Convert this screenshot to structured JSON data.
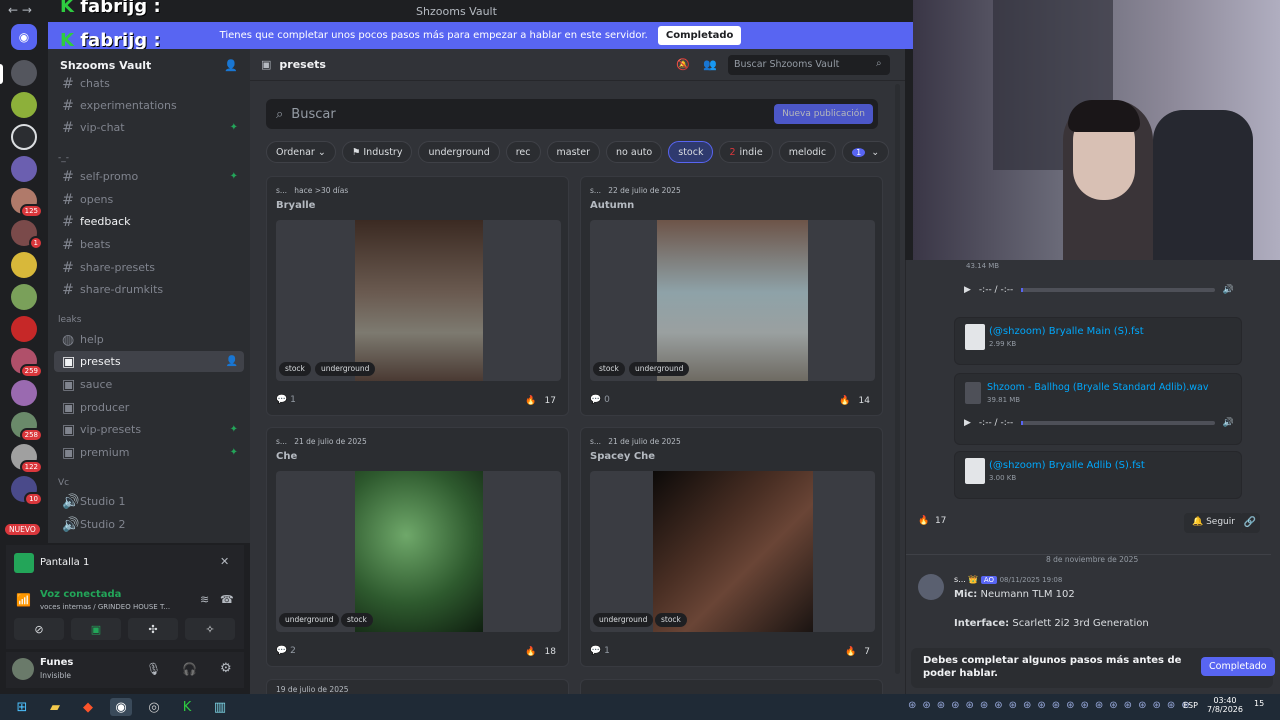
{
  "window": {
    "title": "Shzooms Vault",
    "nav": "← →"
  },
  "overlay_text": "fabrijg :",
  "notice": {
    "text": "Tienes que completar unos pocos pasos más para empezar a hablar en este servidor.",
    "button": "Completado"
  },
  "server": {
    "name": "Shzooms Vault"
  },
  "sidebar": {
    "items": [
      {
        "label": "chats"
      },
      {
        "label": "experimentations"
      },
      {
        "label": "vip-chat"
      },
      {
        "label": "self-promo"
      },
      {
        "label": "opens"
      },
      {
        "label": "feedback"
      },
      {
        "label": "beats"
      },
      {
        "label": "share-presets"
      },
      {
        "label": "share-drumkits"
      },
      {
        "label": "help"
      },
      {
        "label": "presets"
      },
      {
        "label": "sauce"
      },
      {
        "label": "producer"
      },
      {
        "label": "vip-presets"
      },
      {
        "label": "premium"
      },
      {
        "label": "Studio 1"
      },
      {
        "label": "Studio 2"
      }
    ],
    "categories": {
      "c1": "-_-",
      "leaks": "leaks",
      "vc": "Vc"
    }
  },
  "rail_badges": [
    "125",
    "1",
    "259",
    "258",
    "122",
    "10"
  ],
  "rail_new": "NUEVO",
  "voice": {
    "screen": "Pantalla 1",
    "status": "Voz conectada",
    "channel": "voces internas / GRINDEO HOUSE T..."
  },
  "user": {
    "name": "Funes",
    "status": "Invisible"
  },
  "channel": {
    "name": "presets",
    "search_placeholder": "Buscar Shzooms Vault"
  },
  "forum": {
    "search_placeholder": "Buscar",
    "new_post": "Nueva publicación",
    "sort": "Ordenar",
    "tags": [
      {
        "label": "Industry"
      },
      {
        "label": "underground"
      },
      {
        "label": "rec"
      },
      {
        "label": "master"
      },
      {
        "label": "no auto"
      },
      {
        "label": "stock"
      },
      {
        "label": "indie",
        "count": "2"
      },
      {
        "label": "melodic"
      },
      {
        "label": "",
        "count": "1"
      }
    ],
    "posts": [
      {
        "author": "s...",
        "date": "hace >30 días",
        "title": "Bryalle",
        "tags": [
          "stock",
          "underground"
        ],
        "comments": "1",
        "reactions": "17"
      },
      {
        "author": "s...",
        "date": "22 de julio de 2025",
        "title": "Autumn",
        "tags": [
          "stock",
          "underground"
        ],
        "comments": "0",
        "reactions": "14"
      },
      {
        "author": "s...",
        "date": "21 de julio de 2025",
        "title": "Che",
        "tags": [
          "underground",
          "stock"
        ],
        "comments": "2",
        "reactions": "18"
      },
      {
        "author": "s...",
        "date": "21 de julio de 2025",
        "title": "Spacey Che",
        "tags": [
          "underground",
          "stock"
        ],
        "comments": "1",
        "reactions": "7"
      }
    ],
    "next_date": "19 de julio de 2025"
  },
  "thread": {
    "audio1": {
      "size": "43.14 MB",
      "time": "-:-- / -:--"
    },
    "file1": {
      "name": "(@shzoom) Bryalle Main (S).fst",
      "size": "2.99 KB"
    },
    "audio2": {
      "name": "Shzoom - Ballhog (Bryalle Standard Adlib).wav",
      "size": "39.81 MB",
      "time": "-:-- / -:--"
    },
    "file2": {
      "name": "(@shzoom) Bryalle Adlib (S).fst",
      "size": "3.00 KB"
    },
    "reactions": "17",
    "follow": "Seguir",
    "divider": "8 de noviembre de 2025",
    "msg": {
      "author": "s...",
      "tag": "AO",
      "time": "08/11/2025 19:08",
      "mic_label": "Mic:",
      "mic": "Neumann TLM 102",
      "iface_label": "Interface:",
      "iface": "Scarlett 2i2 3rd Generation"
    },
    "notice": {
      "text": "Debes completar algunos pasos más antes de poder hablar.",
      "button": "Completado"
    }
  },
  "taskbar": {
    "lang": "ESP",
    "time": "03:40",
    "date": "7/8/2026",
    "notif": "15"
  }
}
